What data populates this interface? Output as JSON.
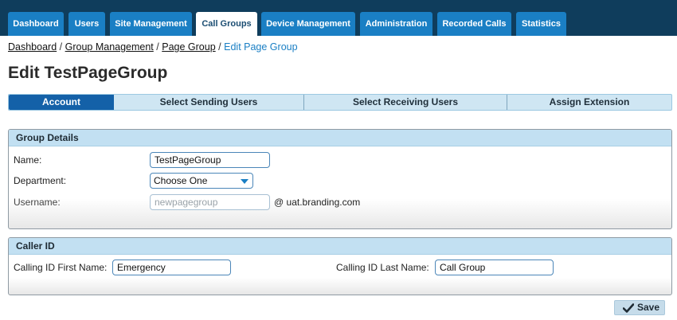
{
  "nav": {
    "tabs": [
      {
        "label": "Dashboard"
      },
      {
        "label": "Users"
      },
      {
        "label": "Site Management"
      },
      {
        "label": "Call Groups",
        "active": true
      },
      {
        "label": "Device Management"
      },
      {
        "label": "Administration"
      },
      {
        "label": "Recorded Calls"
      },
      {
        "label": "Statistics"
      }
    ]
  },
  "breadcrumb": {
    "items": [
      "Dashboard",
      "Group Management",
      "Page Group"
    ],
    "current": "Edit Page Group",
    "separator": "/"
  },
  "page": {
    "title": "Edit TestPageGroup"
  },
  "steps": {
    "items": [
      {
        "label": "Account",
        "active": true
      },
      {
        "label": "Select Sending Users"
      },
      {
        "label": "Select Receiving Users"
      },
      {
        "label": "Assign Extension"
      }
    ]
  },
  "group_details": {
    "heading": "Group Details",
    "name_label": "Name:",
    "name_value": "TestPageGroup",
    "department_label": "Department:",
    "department_value": "Choose One",
    "username_label": "Username:",
    "username_placeholder": "newpagegroup",
    "username_domain": "@ uat.branding.com"
  },
  "caller_id": {
    "heading": "Caller ID",
    "first_name_label": "Calling ID First Name:",
    "first_name_value": "Emergency",
    "last_name_label": "Calling ID Last Name:",
    "last_name_value": "Call Group"
  },
  "actions": {
    "save_label": "Save"
  },
  "colors": {
    "nav_bar": "#0f3d5c",
    "nav_tab": "#1a7fc4",
    "step_active": "#1461a8",
    "panel_header": "#c2e0f2"
  },
  "icons": {
    "save": "checkmark-icon",
    "select": "chevron-down-icon"
  }
}
